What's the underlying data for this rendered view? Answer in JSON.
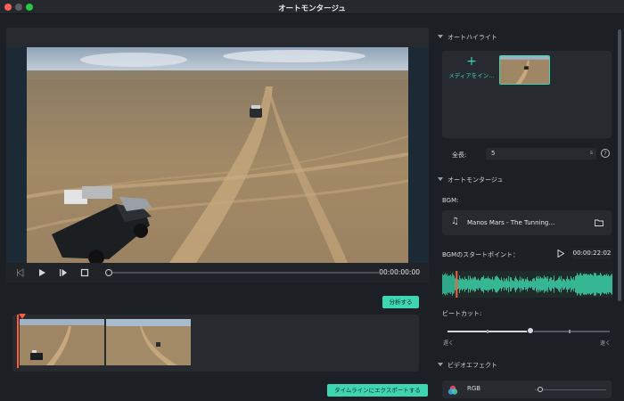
{
  "window": {
    "title": "オートモンタージュ"
  },
  "player": {
    "timecode": "00:00:00:00"
  },
  "timeline": {
    "analyze_label": "分析する",
    "export_label": "タイムラインにエクスポートする"
  },
  "auto_highlight": {
    "header": "オートハイライト",
    "add_media_label": "メディアをイン…",
    "length_label": "全長:",
    "length_value": "5",
    "length_unit": "s",
    "help_glyph": "?"
  },
  "auto_montage": {
    "header": "オートモンタージュ",
    "bgm_label": "BGM:",
    "bgm_track": "Manos Mars - The Tunning…",
    "start_point_label": "BGMのスタートポイント：",
    "start_time": "00:00:22:02",
    "start_point_fraction": 0.08,
    "beat_cut_label": "ビートカット:",
    "beat_cut_value": 0.51,
    "beat_cut_min_label": "遅く",
    "beat_cut_max_label": "速く"
  },
  "video_effect": {
    "header": "ビデオエフェクト",
    "effect_name": "RGB"
  },
  "colors": {
    "accent": "#3ed6b0",
    "playhead": "#ff5a3c",
    "close": "#ff5f57",
    "zoom": "#28c840"
  },
  "icons": [
    "music-note-icon",
    "folder-icon",
    "play-icon",
    "help-icon",
    "rgb-effect-icon",
    "plus-icon"
  ]
}
